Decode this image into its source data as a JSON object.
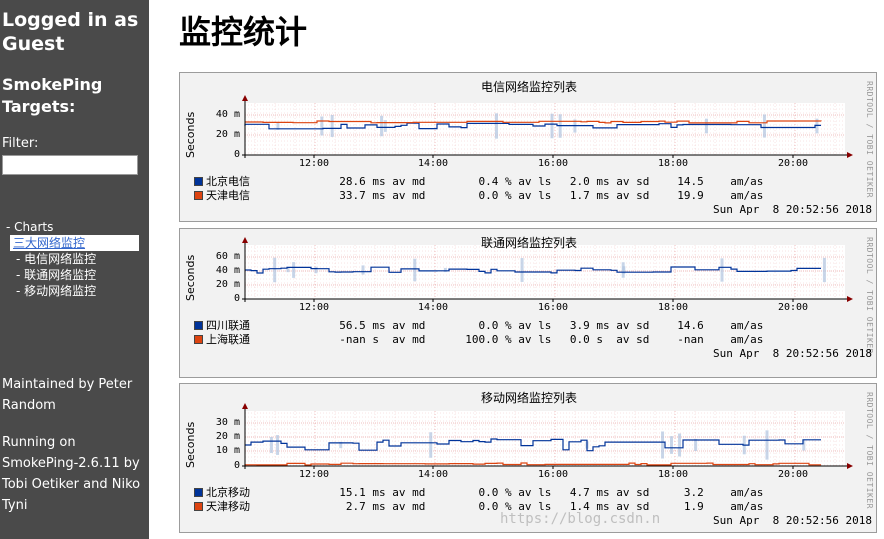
{
  "sidebar": {
    "login": "Logged in as Guest",
    "targets_title": "SmokePing Targets:",
    "filter_label": "Filter:",
    "filter_value": "",
    "menu": [
      {
        "label": "- Charts",
        "level": 0,
        "active": false
      },
      {
        "label": "三大网络监控",
        "level": 1,
        "active": true
      },
      {
        "label": "- 电信网络监控",
        "level": 2,
        "active": false
      },
      {
        "label": "- 联通网络监控",
        "level": 2,
        "active": false
      },
      {
        "label": "- 移动网络监控",
        "level": 2,
        "active": false
      }
    ],
    "maintained": "Maintained by Peter Random",
    "running": "Running on SmokePing-2.6.11 by Tobi Oetiker and Niko Tyni"
  },
  "page_title": "监控统计",
  "watermark": "https://blog.csdn.n",
  "graphs": [
    {
      "title": "电信网络监控列表",
      "ylabel": "Seconds",
      "side_text": "RRDTOOL / TOBI OETIKER",
      "y_ticks": [
        "40 m",
        "20 m",
        "0"
      ],
      "x_ticks": [
        "12:00",
        "14:00",
        "16:00",
        "18:00",
        "20:00"
      ],
      "date": "Sun Apr  8 20:52:56 2018",
      "legend": [
        {
          "name": "北京电信",
          "color": "#003399",
          "median": "28.6",
          "loss": "0.4",
          "sd": "2.0",
          "am": "14.5",
          "median_unit": "ms",
          "sd_unit": "ms"
        },
        {
          "name": "天津电信",
          "color": "#dd4411",
          "median": "33.7",
          "loss": "0.0",
          "sd": "1.7",
          "am": "19.9",
          "median_unit": "ms",
          "sd_unit": "ms"
        }
      ]
    },
    {
      "title": "联通网络监控列表",
      "ylabel": "Seconds",
      "side_text": "RRDTOOL / TOBI OETIKER",
      "y_ticks": [
        "60 m",
        "40 m",
        "20 m",
        "0"
      ],
      "x_ticks": [
        "12:00",
        "14:00",
        "16:00",
        "18:00",
        "20:00"
      ],
      "date": "Sun Apr  8 20:52:56 2018",
      "legend": [
        {
          "name": "四川联通",
          "color": "#003399",
          "median": "56.5",
          "loss": "0.0",
          "sd": "3.9",
          "am": "14.6",
          "median_unit": "ms",
          "sd_unit": "ms"
        },
        {
          "name": "上海联通",
          "color": "#dd4411",
          "median": "-nan",
          "loss": "100.0",
          "sd": "0.0",
          "am": "-nan",
          "median_unit": "s",
          "sd_unit": "s"
        }
      ]
    },
    {
      "title": "移动网络监控列表",
      "ylabel": "Seconds",
      "side_text": "RRDTOOL / TOBI OETIKER",
      "y_ticks": [
        "30 m",
        "20 m",
        "10 m",
        "0"
      ],
      "x_ticks": [
        "12:00",
        "14:00",
        "16:00",
        "18:00",
        "20:00"
      ],
      "date": "Sun Apr  8 20:52:56 2018",
      "legend": [
        {
          "name": "北京移动",
          "color": "#003399",
          "median": "15.1",
          "loss": "0.0",
          "sd": "4.7",
          "am": "3.2",
          "median_unit": "ms",
          "sd_unit": "ms"
        },
        {
          "name": "天津移动",
          "color": "#dd4411",
          "median": "2.7",
          "loss": "0.0",
          "sd": "1.4",
          "am": "1.9",
          "median_unit": "ms",
          "sd_unit": "ms"
        }
      ]
    }
  ],
  "legend_labels": {
    "av_md": "av md",
    "av_ls": "av ls",
    "av_sd": "av sd",
    "am_as": "am/as",
    "pct": "%"
  }
}
